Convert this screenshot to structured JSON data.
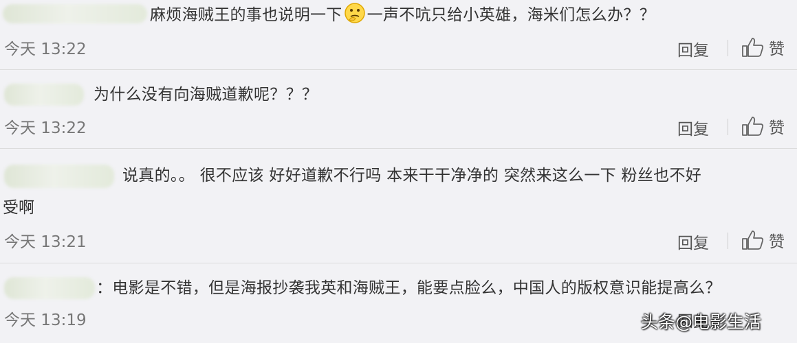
{
  "comments": [
    {
      "text_before": "麻烦海贼王的事也说明一下",
      "emoji_name": "thinking-face-icon",
      "text_after": "一声不吭只给小英雄，海米们怎么办？？",
      "time": "今天 13:22",
      "reply_label": "回复",
      "like_label": "赞"
    },
    {
      "text": "为什么没有向海贼道歉呢？？？",
      "time": "今天 13:22",
      "reply_label": "回复",
      "like_label": "赞"
    },
    {
      "text_line1": "说真的。。 很不应该 好好道歉不行吗 本来干干净净的 突然来这么一下 粉丝也不好",
      "text_line2": "受啊",
      "time": "今天 13:21",
      "reply_label": "回复",
      "like_label": "赞"
    },
    {
      "text": "：电影是不错，但是海报抄袭我英和海贼王，能要点脸么，中国人的版权意识能提高么？",
      "time": "今天 13:19",
      "reply_label": "回复",
      "like_label": "赞"
    }
  ],
  "watermark": "头条@电影生活",
  "colors": {
    "background": "#f2f2f5",
    "text": "#333333",
    "muted": "#777777",
    "divider": "#dcdcdc"
  }
}
